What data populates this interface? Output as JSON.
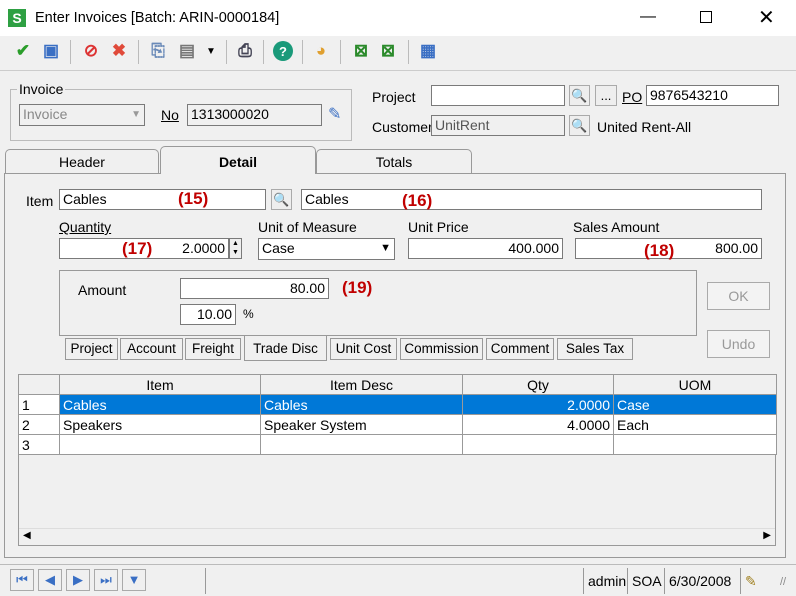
{
  "window": {
    "title": "Enter Invoices [Batch: ARIN-0000184]",
    "app_icon": "S"
  },
  "invoice": {
    "group_label": "Invoice",
    "type_value": "Invoice",
    "no_label": "No",
    "no_value": "1313000020"
  },
  "project": {
    "label": "Project",
    "value": "",
    "po_label": "PO",
    "po_value": "9876543210",
    "browse": "..."
  },
  "customer": {
    "label": "Customer",
    "value": "UnitRent",
    "name": "United Rent-All"
  },
  "tabs": [
    {
      "label": "Header"
    },
    {
      "label": "Detail"
    },
    {
      "label": "Totals"
    }
  ],
  "detail": {
    "item_label": "Item",
    "item_value": "Cables",
    "desc_value": "Cables",
    "quantity_label": "Quantity",
    "quantity_value": "2.0000",
    "uom_label": "Unit of Measure",
    "uom_value": "Case",
    "unit_price_label": "Unit Price",
    "unit_price_value": "400.000",
    "sales_amount_label": "Sales Amount",
    "sales_amount_value": "800.00",
    "amount_label": "Amount",
    "amount_value": "80.00",
    "percent_value": "10.00",
    "percent_sign": "%",
    "ok": "OK",
    "undo": "Undo",
    "annotations": [
      "(15)",
      "(16)",
      "(17)",
      "(18)",
      "(19)"
    ]
  },
  "subtabs": [
    "Project",
    "Account",
    "Freight",
    "Trade Disc",
    "Unit Cost",
    "Commission",
    "Comment",
    "Sales Tax"
  ],
  "grid": {
    "columns": [
      "Item",
      "Item Desc",
      "Qty",
      "UOM"
    ],
    "rows": [
      {
        "n": "1",
        "item": "Cables",
        "desc": "Cables",
        "qty": "2.0000",
        "uom": "Case"
      },
      {
        "n": "2",
        "item": "Speakers",
        "desc": "Speaker System",
        "qty": "4.0000",
        "uom": "Each"
      },
      {
        "n": "3",
        "item": "",
        "desc": "",
        "qty": "",
        "uom": ""
      }
    ]
  },
  "status": {
    "user": "admin",
    "company": "SOA",
    "date": "6/30/2008"
  }
}
